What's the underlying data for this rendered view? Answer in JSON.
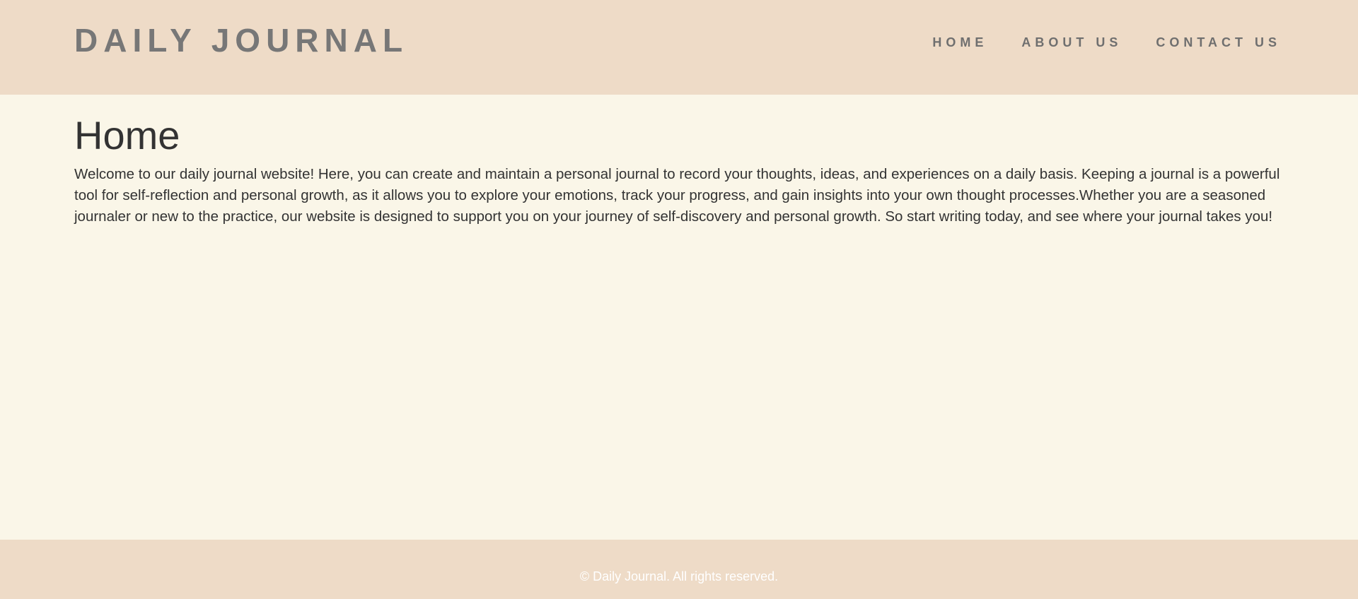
{
  "header": {
    "brand": "DAILY JOURNAL",
    "nav": {
      "home": "HOME",
      "about": "ABOUT US",
      "contact": "CONTACT US"
    }
  },
  "main": {
    "title": "Home",
    "intro": "Welcome to our daily journal website! Here, you can create and maintain a personal journal to record your thoughts, ideas, and experiences on a daily basis. Keeping a journal is a powerful tool for self-reflection and personal growth, as it allows you to explore your emotions, track your progress, and gain insights into your own thought processes.Whether you are a seasoned journaler or new to the practice, our website is designed to support you on your journey of self-discovery and personal growth. So start writing today, and see where your journal takes you!"
  },
  "footer": {
    "copyright": "© Daily Journal. All rights reserved."
  },
  "colors": {
    "header_background": "#eedbc7",
    "page_background": "#faf6e8",
    "text": "#333333",
    "brand_text": "#777777",
    "footer_text": "#ffffff"
  }
}
